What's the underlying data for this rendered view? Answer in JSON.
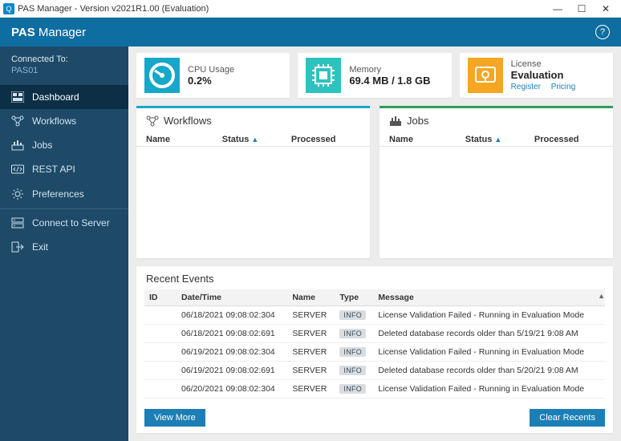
{
  "window": {
    "title": "PAS Manager - Version v2021R1.00 (Evaluation)",
    "app_icon_letter": "Q"
  },
  "header": {
    "app_bold": "PAS",
    "app_light": "Manager"
  },
  "sidebar": {
    "connected_label": "Connected To:",
    "connected_value": "PAS01",
    "items": [
      {
        "label": "Dashboard"
      },
      {
        "label": "Workflows"
      },
      {
        "label": "Jobs"
      },
      {
        "label": "REST API"
      },
      {
        "label": "Preferences"
      },
      {
        "label": "Connect to Server"
      },
      {
        "label": "Exit"
      }
    ]
  },
  "cards": {
    "cpu": {
      "label": "CPU Usage",
      "value": "0.2%"
    },
    "memory": {
      "label": "Memory",
      "value": "69.4 MB / 1.8 GB"
    },
    "license": {
      "label": "License",
      "value": "Evaluation",
      "link_register": "Register",
      "link_pricing": "Pricing"
    }
  },
  "workflows_panel": {
    "title": "Workflows",
    "col_name": "Name",
    "col_status": "Status",
    "col_processed": "Processed"
  },
  "jobs_panel": {
    "title": "Jobs",
    "col_name": "Name",
    "col_status": "Status",
    "col_processed": "Processed"
  },
  "events": {
    "title": "Recent Events",
    "col_id": "ID",
    "col_dt": "Date/Time",
    "col_name": "Name",
    "col_type": "Type",
    "col_msg": "Message",
    "rows": [
      {
        "dt": "06/18/2021 09:08:02:304",
        "name": "SERVER",
        "type": "INFO",
        "msg": "License Validation Failed - Running in Evaluation Mode"
      },
      {
        "dt": "06/18/2021 09:08:02:691",
        "name": "SERVER",
        "type": "INFO",
        "msg": "Deleted database records older than 5/19/21 9:08 AM"
      },
      {
        "dt": "06/19/2021 09:08:02:304",
        "name": "SERVER",
        "type": "INFO",
        "msg": "License Validation Failed - Running in Evaluation Mode"
      },
      {
        "dt": "06/19/2021 09:08:02:691",
        "name": "SERVER",
        "type": "INFO",
        "msg": "Deleted database records older than 5/20/21 9:08 AM"
      },
      {
        "dt": "06/20/2021 09:08:02:304",
        "name": "SERVER",
        "type": "INFO",
        "msg": "License Validation Failed - Running in Evaluation Mode"
      }
    ],
    "btn_view_more": "View More",
    "btn_clear": "Clear Recents"
  }
}
